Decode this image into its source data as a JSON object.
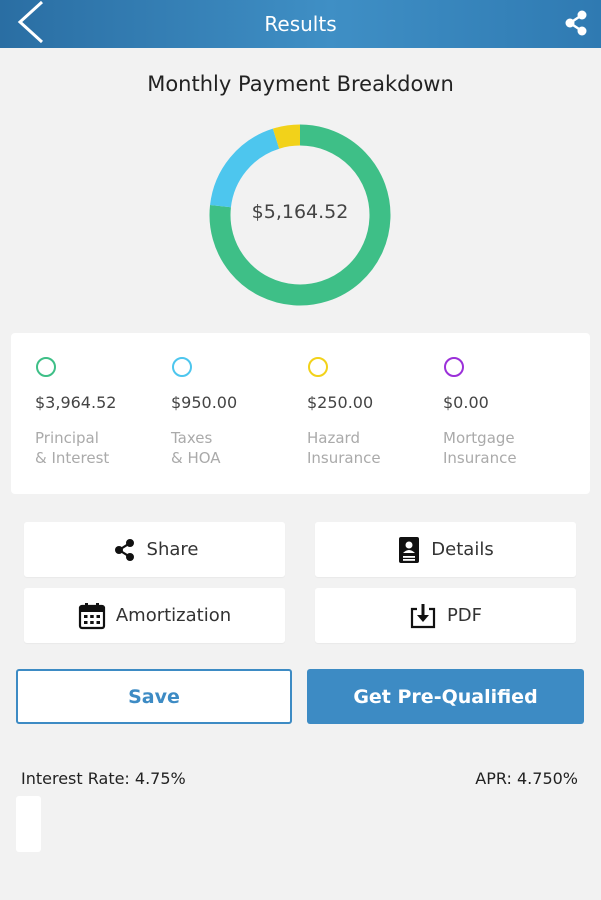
{
  "header": {
    "title": "Results"
  },
  "chart": {
    "title": "Monthly Payment Breakdown",
    "total": "$5,164.52"
  },
  "chart_data": {
    "type": "pie",
    "categories": [
      "Principal & Interest",
      "Taxes & HOA",
      "Hazard Insurance",
      "Mortgage Insurance"
    ],
    "values": [
      3964.52,
      950.0,
      250.0,
      0.0
    ],
    "colors": [
      "#3ebf87",
      "#4dc6ee",
      "#f2d21a",
      "#9b30d9"
    ]
  },
  "legend": [
    {
      "value": "$3,964.52",
      "line1": "Principal",
      "line2": "& Interest",
      "color": "#3ebf87"
    },
    {
      "value": "$950.00",
      "line1": "Taxes",
      "line2": "& HOA",
      "color": "#4dc6ee"
    },
    {
      "value": "$250.00",
      "line1": "Hazard",
      "line2": "Insurance",
      "color": "#f2d21a"
    },
    {
      "value": "$0.00",
      "line1": "Mortgage",
      "line2": "Insurance",
      "color": "#9b30d9"
    }
  ],
  "actions": {
    "share": "Share",
    "details": "Details",
    "amortization": "Amortization",
    "pdf": "PDF"
  },
  "buttons": {
    "save": "Save",
    "prequalify": "Get Pre-Qualified"
  },
  "rates": {
    "interest": "Interest Rate: 4.75%",
    "apr": "APR: 4.750%"
  }
}
